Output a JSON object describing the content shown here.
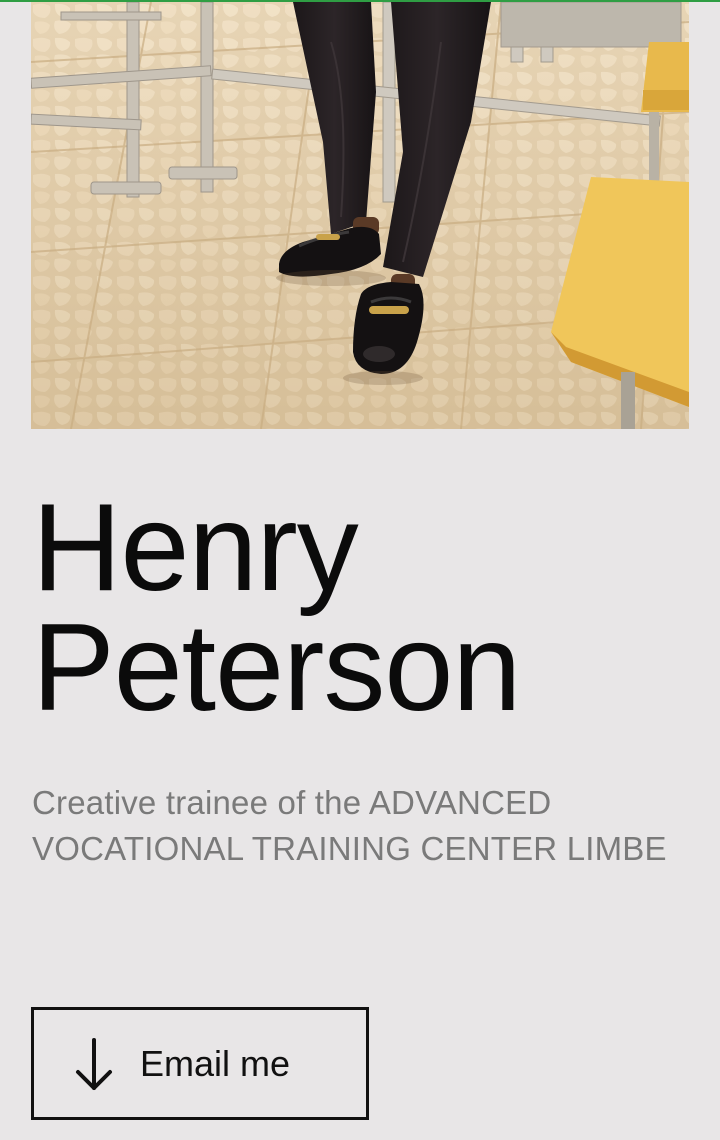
{
  "profile": {
    "first_name": "Henry",
    "last_name": "Peterson",
    "tagline": "Creative trainee of the ADVANCED VOCATIONAL TRAINING CENTER LIMBE"
  },
  "cta": {
    "label": "Email me",
    "icon": "arrow-down-icon"
  },
  "photo": {
    "subject": "profile-photo"
  },
  "colors": {
    "background": "#e8e6e7",
    "text": "#0b0b0b",
    "muted_text": "#7a7a7a",
    "accent_bar": "#2f9e44"
  }
}
